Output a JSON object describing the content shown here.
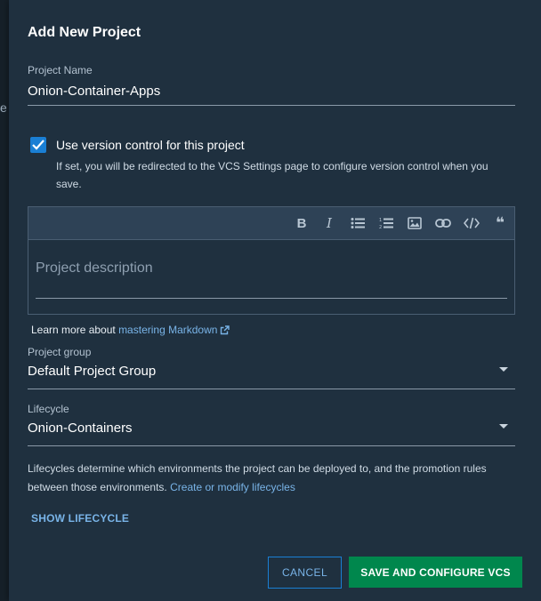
{
  "dialog": {
    "title": "Add New Project"
  },
  "project_name": {
    "label": "Project Name",
    "value": "Onion-Container-Apps"
  },
  "version_control": {
    "checked": true,
    "label": "Use version control for this project",
    "help": "If set, you will be redirected to the VCS Settings page to configure version control when you save."
  },
  "editor": {
    "toolbar": [
      "bold-icon",
      "italic-icon",
      "bullet-list-icon",
      "numbered-list-icon",
      "image-icon",
      "link-icon",
      "code-icon",
      "quote-icon"
    ],
    "bold_glyph": "B",
    "italic_glyph": "I",
    "quote_glyph": "❝",
    "placeholder": "Project description"
  },
  "markdown": {
    "prefix": "Learn more about ",
    "link": "mastering Markdown"
  },
  "project_group": {
    "label": "Project group",
    "value": "Default Project Group"
  },
  "lifecycle": {
    "label": "Lifecycle",
    "value": "Onion-Containers",
    "help_text": "Lifecycles determine which environments the project can be deployed to, and the promotion rules between those environments. ",
    "help_link": "Create or modify lifecycles",
    "show_label": "SHOW LIFECYCLE"
  },
  "actions": {
    "cancel": "CANCEL",
    "save": "SAVE AND CONFIGURE VCS"
  },
  "colors": {
    "accent": "#1a7fd4",
    "primary_button": "#00874d",
    "link": "#79b4e8",
    "dialog_bg": "#1f303f"
  }
}
